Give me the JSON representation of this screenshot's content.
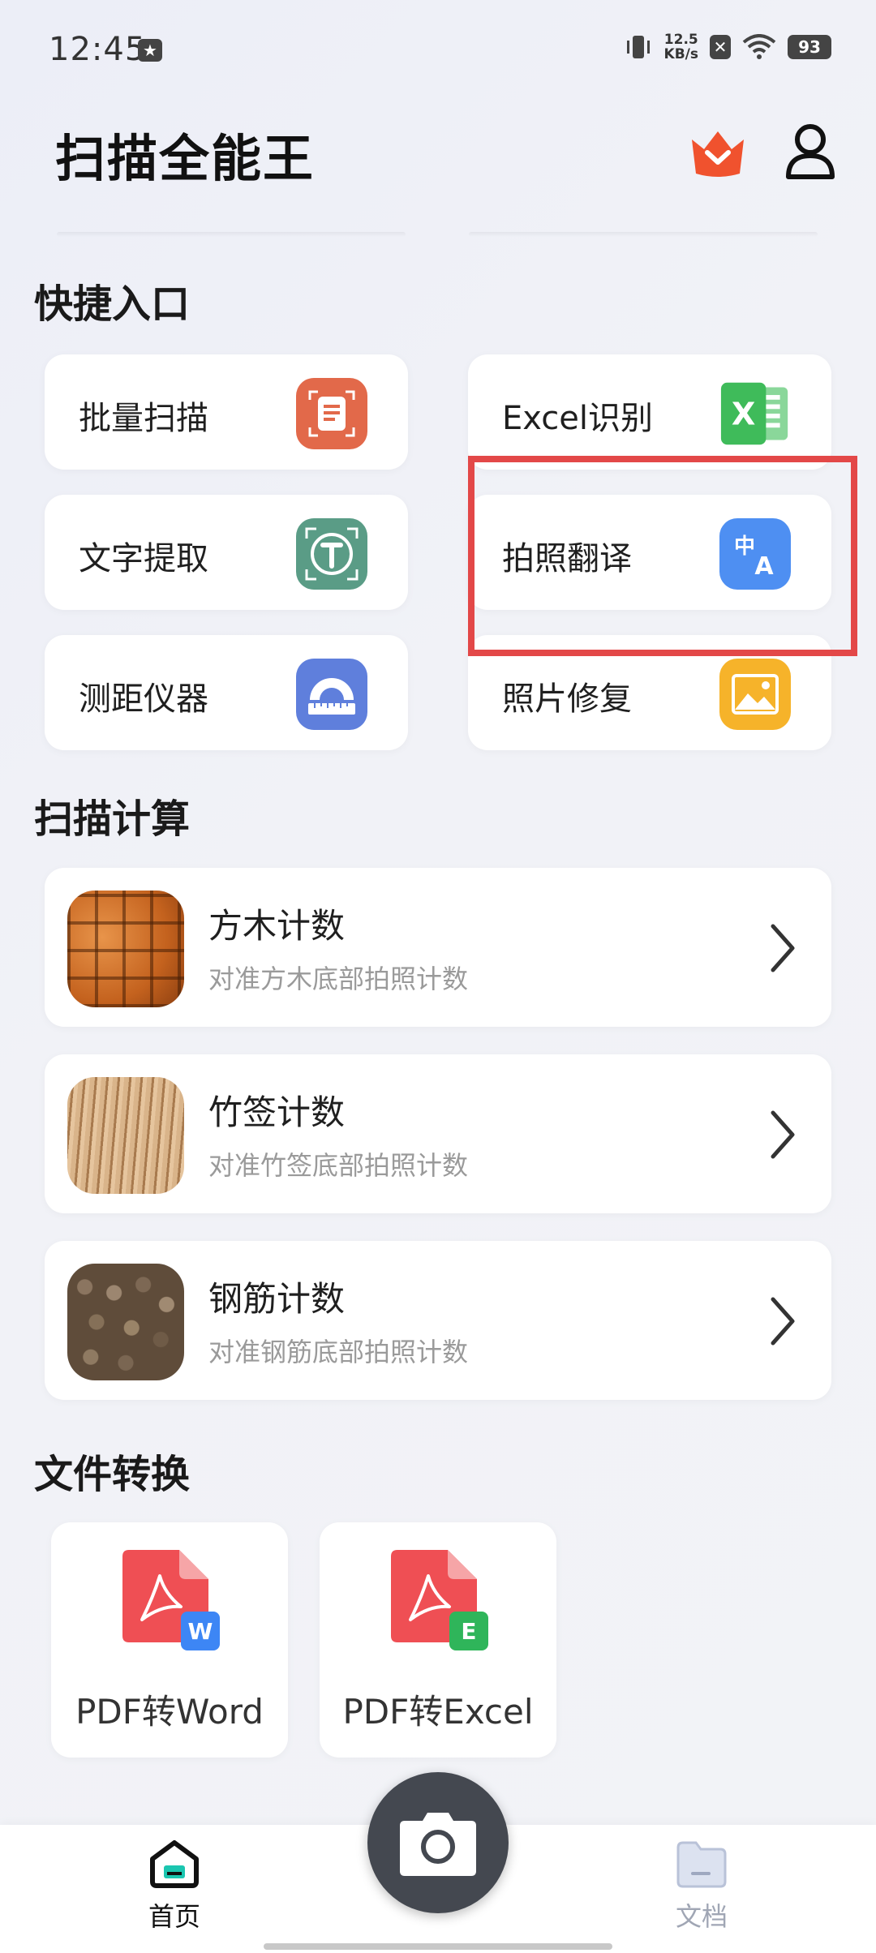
{
  "status_bar": {
    "time": "12:45",
    "speed_value": "12.5",
    "speed_unit": "KB/s",
    "battery": "93"
  },
  "header": {
    "title": "扫描全能王",
    "crown_icon": "vip-crown-icon",
    "user_icon": "user-icon",
    "brand_color": "#f0522e"
  },
  "quick_access": {
    "title": "快捷入口",
    "items": [
      {
        "label": "批量扫描",
        "icon": "batch-scan-icon",
        "color": "#e2694a"
      },
      {
        "label": "Excel识别",
        "icon": "excel-icon",
        "color": "#3fbb5a"
      },
      {
        "label": "文字提取",
        "icon": "text-extract-icon",
        "color": "#5a9c86"
      },
      {
        "label": "拍照翻译",
        "icon": "translate-icon",
        "color": "#4e8ff2"
      },
      {
        "label": "测距仪器",
        "icon": "ruler-icon",
        "color": "#5f7fdc"
      },
      {
        "label": "照片修复",
        "icon": "photo-restore-icon",
        "color": "#f6b32a"
      }
    ],
    "highlight_color": "#e34848"
  },
  "scan_calc": {
    "title": "扫描计算",
    "items": [
      {
        "title": "方木计数",
        "subtitle": "对准方木底部拍照计数"
      },
      {
        "title": "竹签计数",
        "subtitle": "对准竹签底部拍照计数"
      },
      {
        "title": "钢筋计数",
        "subtitle": "对准钢筋底部拍照计数"
      }
    ]
  },
  "file_convert": {
    "title": "文件转换",
    "items": [
      {
        "label": "PDF转Word",
        "badge": "W",
        "badge_color": "#3d86f5"
      },
      {
        "label": "PDF转Excel",
        "badge": "E",
        "badge_color": "#2fb55a"
      }
    ]
  },
  "bottom_nav": {
    "home_label": "首页",
    "docs_label": "文档"
  }
}
